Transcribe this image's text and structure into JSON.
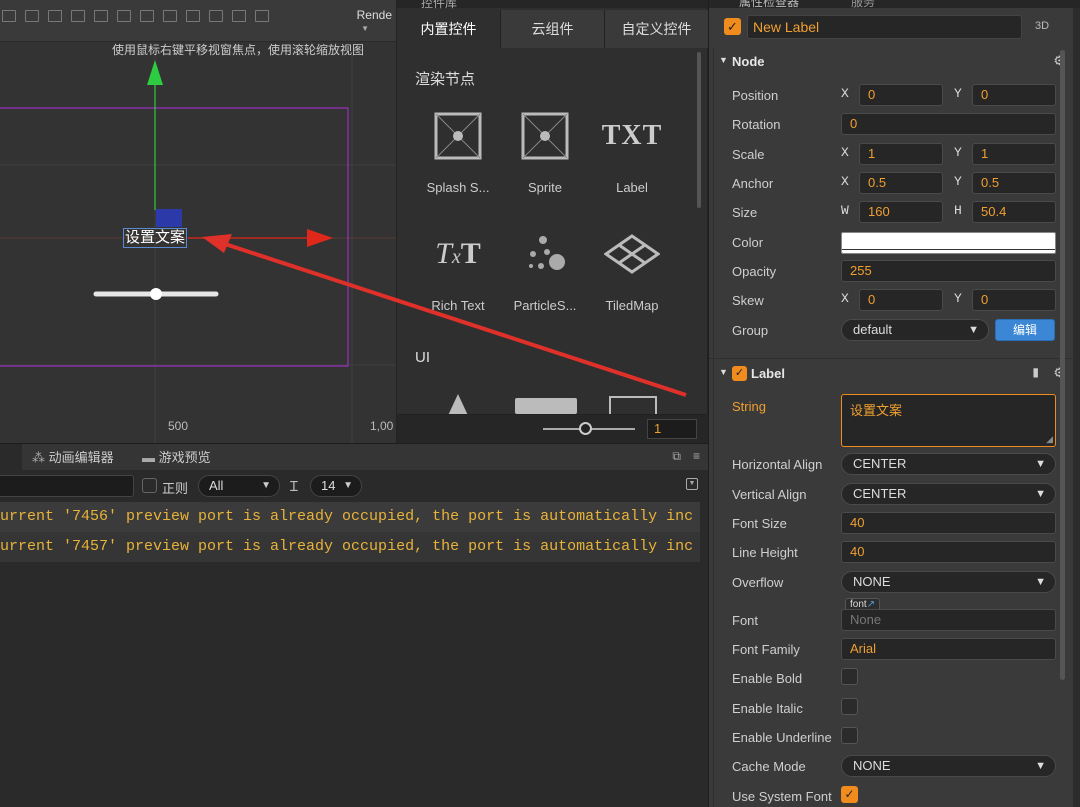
{
  "scene": {
    "render_label": "Rende",
    "hint": "使用鼠标右键平移视窗焦点，使用滚轮缩放视图",
    "ruler_500": "500",
    "ruler_1000": "1,00",
    "label_text": "设置文案"
  },
  "library": {
    "title": "控件库",
    "tabs": [
      "内置控件",
      "云组件",
      "自定义控件"
    ],
    "section_render": "渲染节点",
    "section_ui": "UI",
    "items": [
      {
        "label": "Splash S...",
        "icon": "splash-screen-icon"
      },
      {
        "label": "Sprite",
        "icon": "sprite-icon"
      },
      {
        "label": "Label",
        "icon": "label-txt-icon"
      },
      {
        "label": "Rich Text",
        "icon": "rich-text-icon"
      },
      {
        "label": "ParticleS...",
        "icon": "particle-system-icon"
      },
      {
        "label": "TiledMap",
        "icon": "tiled-map-icon"
      }
    ],
    "zoom_value": "1"
  },
  "console": {
    "tabs": [
      "动画编辑器",
      "游戏预览"
    ],
    "regex_label": "正则",
    "level_filter": "All",
    "font_size": "14",
    "logs": [
      "urrent '7456' preview port is already occupied, the port is automatically inc",
      "urrent '7457' preview port is already occupied, the port is automatically inc"
    ]
  },
  "inspector": {
    "tab_title": "属性检查器",
    "tab_2": "服务",
    "node_name": "New Label",
    "mode_3d": "3D",
    "node_section": "Node",
    "position": {
      "label": "Position",
      "x": "0",
      "y": "0"
    },
    "rotation": {
      "label": "Rotation",
      "value": "0"
    },
    "scale": {
      "label": "Scale",
      "x": "1",
      "y": "1"
    },
    "anchor": {
      "label": "Anchor",
      "x": "0.5",
      "y": "0.5"
    },
    "size": {
      "label": "Size",
      "w": "160",
      "h": "50.4"
    },
    "color": {
      "label": "Color",
      "value": "#ffffff"
    },
    "opacity": {
      "label": "Opacity",
      "value": "255"
    },
    "skew": {
      "label": "Skew",
      "x": "0",
      "y": "0"
    },
    "group": {
      "label": "Group",
      "value": "default",
      "button": "编辑"
    },
    "label_section": "Label",
    "string": {
      "label": "String",
      "value": "设置文案"
    },
    "h_align": {
      "label": "Horizontal Align",
      "value": "CENTER"
    },
    "v_align": {
      "label": "Vertical Align",
      "value": "CENTER"
    },
    "font_size": {
      "label": "Font Size",
      "value": "40"
    },
    "line_height": {
      "label": "Line Height",
      "value": "40"
    },
    "overflow": {
      "label": "Overflow",
      "value": "NONE"
    },
    "font": {
      "label": "Font",
      "tag": "font",
      "value": "None"
    },
    "font_family": {
      "label": "Font Family",
      "value": "Arial"
    },
    "enable_bold": {
      "label": "Enable Bold",
      "checked": false
    },
    "enable_italic": {
      "label": "Enable Italic",
      "checked": false
    },
    "enable_underline": {
      "label": "Enable Underline",
      "checked": false
    },
    "cache_mode": {
      "label": "Cache Mode",
      "value": "NONE"
    },
    "use_system_font": {
      "label": "Use System Font",
      "checked": true
    },
    "axis": {
      "x": "X",
      "y": "Y",
      "w": "W",
      "h": "H"
    }
  },
  "colors": {
    "accent": "#f08c1e",
    "value_text": "#f0a030",
    "button_blue": "#3b87d6",
    "annotation_arrow": "#e0302a",
    "gizmo_green": "#2ecc40",
    "gizmo_red": "#e0281a",
    "canvas_border": "#9b30c0"
  }
}
